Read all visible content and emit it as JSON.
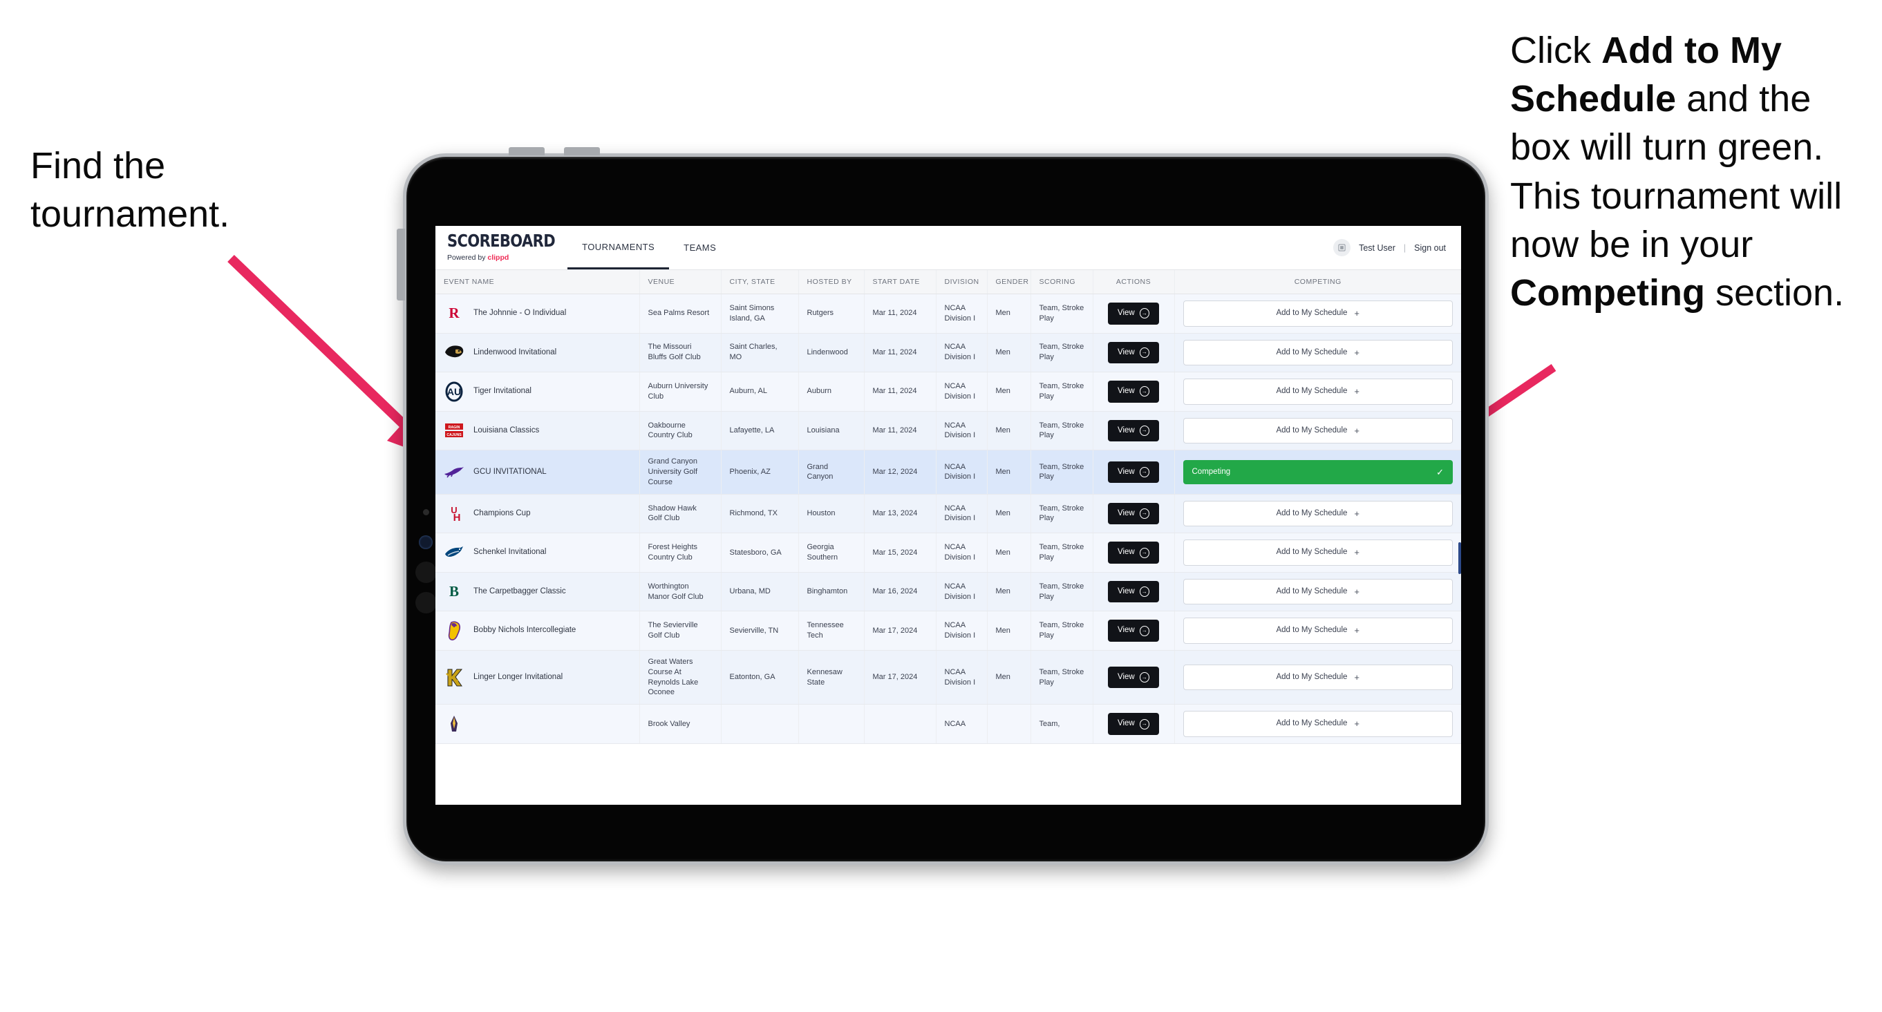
{
  "annotations": {
    "left": {
      "line1": "Find the",
      "line2": "tournament."
    },
    "right": {
      "part1": "Click ",
      "bold1": "Add to My Schedule",
      "part2": " and the box will turn green. This tournament will now be in your ",
      "bold2": "Competing",
      "part3": " section."
    }
  },
  "arrow_color": "#e8285f",
  "app": {
    "brand": {
      "title": "SCOREBOARD",
      "powered_prefix": "Powered by ",
      "powered_name": "clippd"
    },
    "nav_tabs": [
      {
        "label": "TOURNAMENTS",
        "active": true
      },
      {
        "label": "TEAMS",
        "active": false
      }
    ],
    "user": {
      "avatar_icon": "user-avatar-icon",
      "name": "Test User",
      "separator": "|",
      "sign_out": "Sign out"
    }
  },
  "table": {
    "columns": [
      "EVENT NAME",
      "VENUE",
      "CITY, STATE",
      "HOSTED BY",
      "START DATE",
      "DIVISION",
      "GENDER",
      "SCORING",
      "ACTIONS",
      "COMPETING"
    ],
    "buttons": {
      "view": "View",
      "view_icon": "arrow-right-circle-icon",
      "add": "Add to My Schedule",
      "add_icon": "plus-icon",
      "competing": "Competing",
      "competing_icon": "check-icon"
    },
    "rows": [
      {
        "event": "The Johnnie - O Individual",
        "venue": "Sea Palms Resort",
        "city": "Saint Simons Island, GA",
        "host": "Rutgers",
        "date": "Mar 11, 2024",
        "division": "NCAA Division I",
        "gender": "Men",
        "scoring": "Team, Stroke Play",
        "competing": false,
        "logo_text": "R",
        "logo_color": "#cc0033",
        "logo_shape": "letter"
      },
      {
        "event": "Lindenwood Invitational",
        "venue": "The Missouri Bluffs Golf Club",
        "city": "Saint Charles, MO",
        "host": "Lindenwood",
        "date": "Mar 11, 2024",
        "division": "NCAA Division I",
        "gender": "Men",
        "scoring": "Team, Stroke Play",
        "competing": false,
        "logo_text": "",
        "logo_color": "#1a1a1a",
        "logo_shape": "lion"
      },
      {
        "event": "Tiger Invitational",
        "venue": "Auburn University Club",
        "city": "Auburn, AL",
        "host": "Auburn",
        "date": "Mar 11, 2024",
        "division": "NCAA Division I",
        "gender": "Men",
        "scoring": "Team, Stroke Play",
        "competing": false,
        "logo_text": "AU",
        "logo_color": "#0c2340",
        "logo_shape": "au"
      },
      {
        "event": "Louisiana Classics",
        "venue": "Oakbourne Country Club",
        "city": "Lafayette, LA",
        "host": "Louisiana",
        "date": "Mar 11, 2024",
        "division": "NCAA Division I",
        "gender": "Men",
        "scoring": "Team, Stroke Play",
        "competing": false,
        "logo_text": "RAGIN CAJUNS",
        "logo_color": "#ce181e",
        "logo_shape": "block"
      },
      {
        "event": "GCU INVITATIONAL",
        "venue": "Grand Canyon University Golf Course",
        "city": "Phoenix, AZ",
        "host": "Grand Canyon",
        "date": "Mar 12, 2024",
        "division": "NCAA Division I",
        "gender": "Men",
        "scoring": "Team, Stroke Play",
        "competing": true,
        "logo_text": "",
        "logo_color": "#522398",
        "logo_shape": "lope"
      },
      {
        "event": "Champions Cup",
        "venue": "Shadow Hawk Golf Club",
        "city": "Richmond, TX",
        "host": "Houston",
        "date": "Mar 13, 2024",
        "division": "NCAA Division I",
        "gender": "Men",
        "scoring": "Team, Stroke Play",
        "competing": false,
        "logo_text": "UH",
        "logo_color": "#c8102e",
        "logo_shape": "uh"
      },
      {
        "event": "Schenkel Invitational",
        "venue": "Forest Heights Country Club",
        "city": "Statesboro, GA",
        "host": "Georgia Southern",
        "date": "Mar 15, 2024",
        "division": "NCAA Division I",
        "gender": "Men",
        "scoring": "Team, Stroke Play",
        "competing": false,
        "logo_text": "",
        "logo_color": "#00457c",
        "logo_shape": "eagle"
      },
      {
        "event": "The Carpetbagger Classic",
        "venue": "Worthington Manor Golf Club",
        "city": "Urbana, MD",
        "host": "Binghamton",
        "date": "Mar 16, 2024",
        "division": "NCAA Division I",
        "gender": "Men",
        "scoring": "Team, Stroke Play",
        "competing": false,
        "logo_text": "B",
        "logo_color": "#005a43",
        "logo_shape": "letter"
      },
      {
        "event": "Bobby Nichols Intercollegiate",
        "venue": "The Sevierville Golf Club",
        "city": "Sevierville, TN",
        "host": "Tennessee Tech",
        "date": "Mar 17, 2024",
        "division": "NCAA Division I",
        "gender": "Men",
        "scoring": "Team, Stroke Play",
        "competing": false,
        "logo_text": "",
        "logo_color": "#6a2a8c",
        "logo_shape": "eagle-gold"
      },
      {
        "event": "Linger Longer Invitational",
        "venue": "Great Waters Course At Reynolds Lake Oconee",
        "city": "Eatonton, GA",
        "host": "Kennesaw State",
        "date": "Mar 17, 2024",
        "division": "NCAA Division I",
        "gender": "Men",
        "scoring": "Team, Stroke Play",
        "competing": false,
        "logo_text": "KS",
        "logo_color": "#c8a217",
        "logo_shape": "ks"
      },
      {
        "event": "",
        "venue": "Brook Valley",
        "city": "",
        "host": "",
        "date": "",
        "division": "NCAA",
        "gender": "",
        "scoring": "Team,",
        "competing": false,
        "logo_text": "",
        "logo_color": "#3b2a5a",
        "logo_shape": "partial"
      }
    ]
  }
}
